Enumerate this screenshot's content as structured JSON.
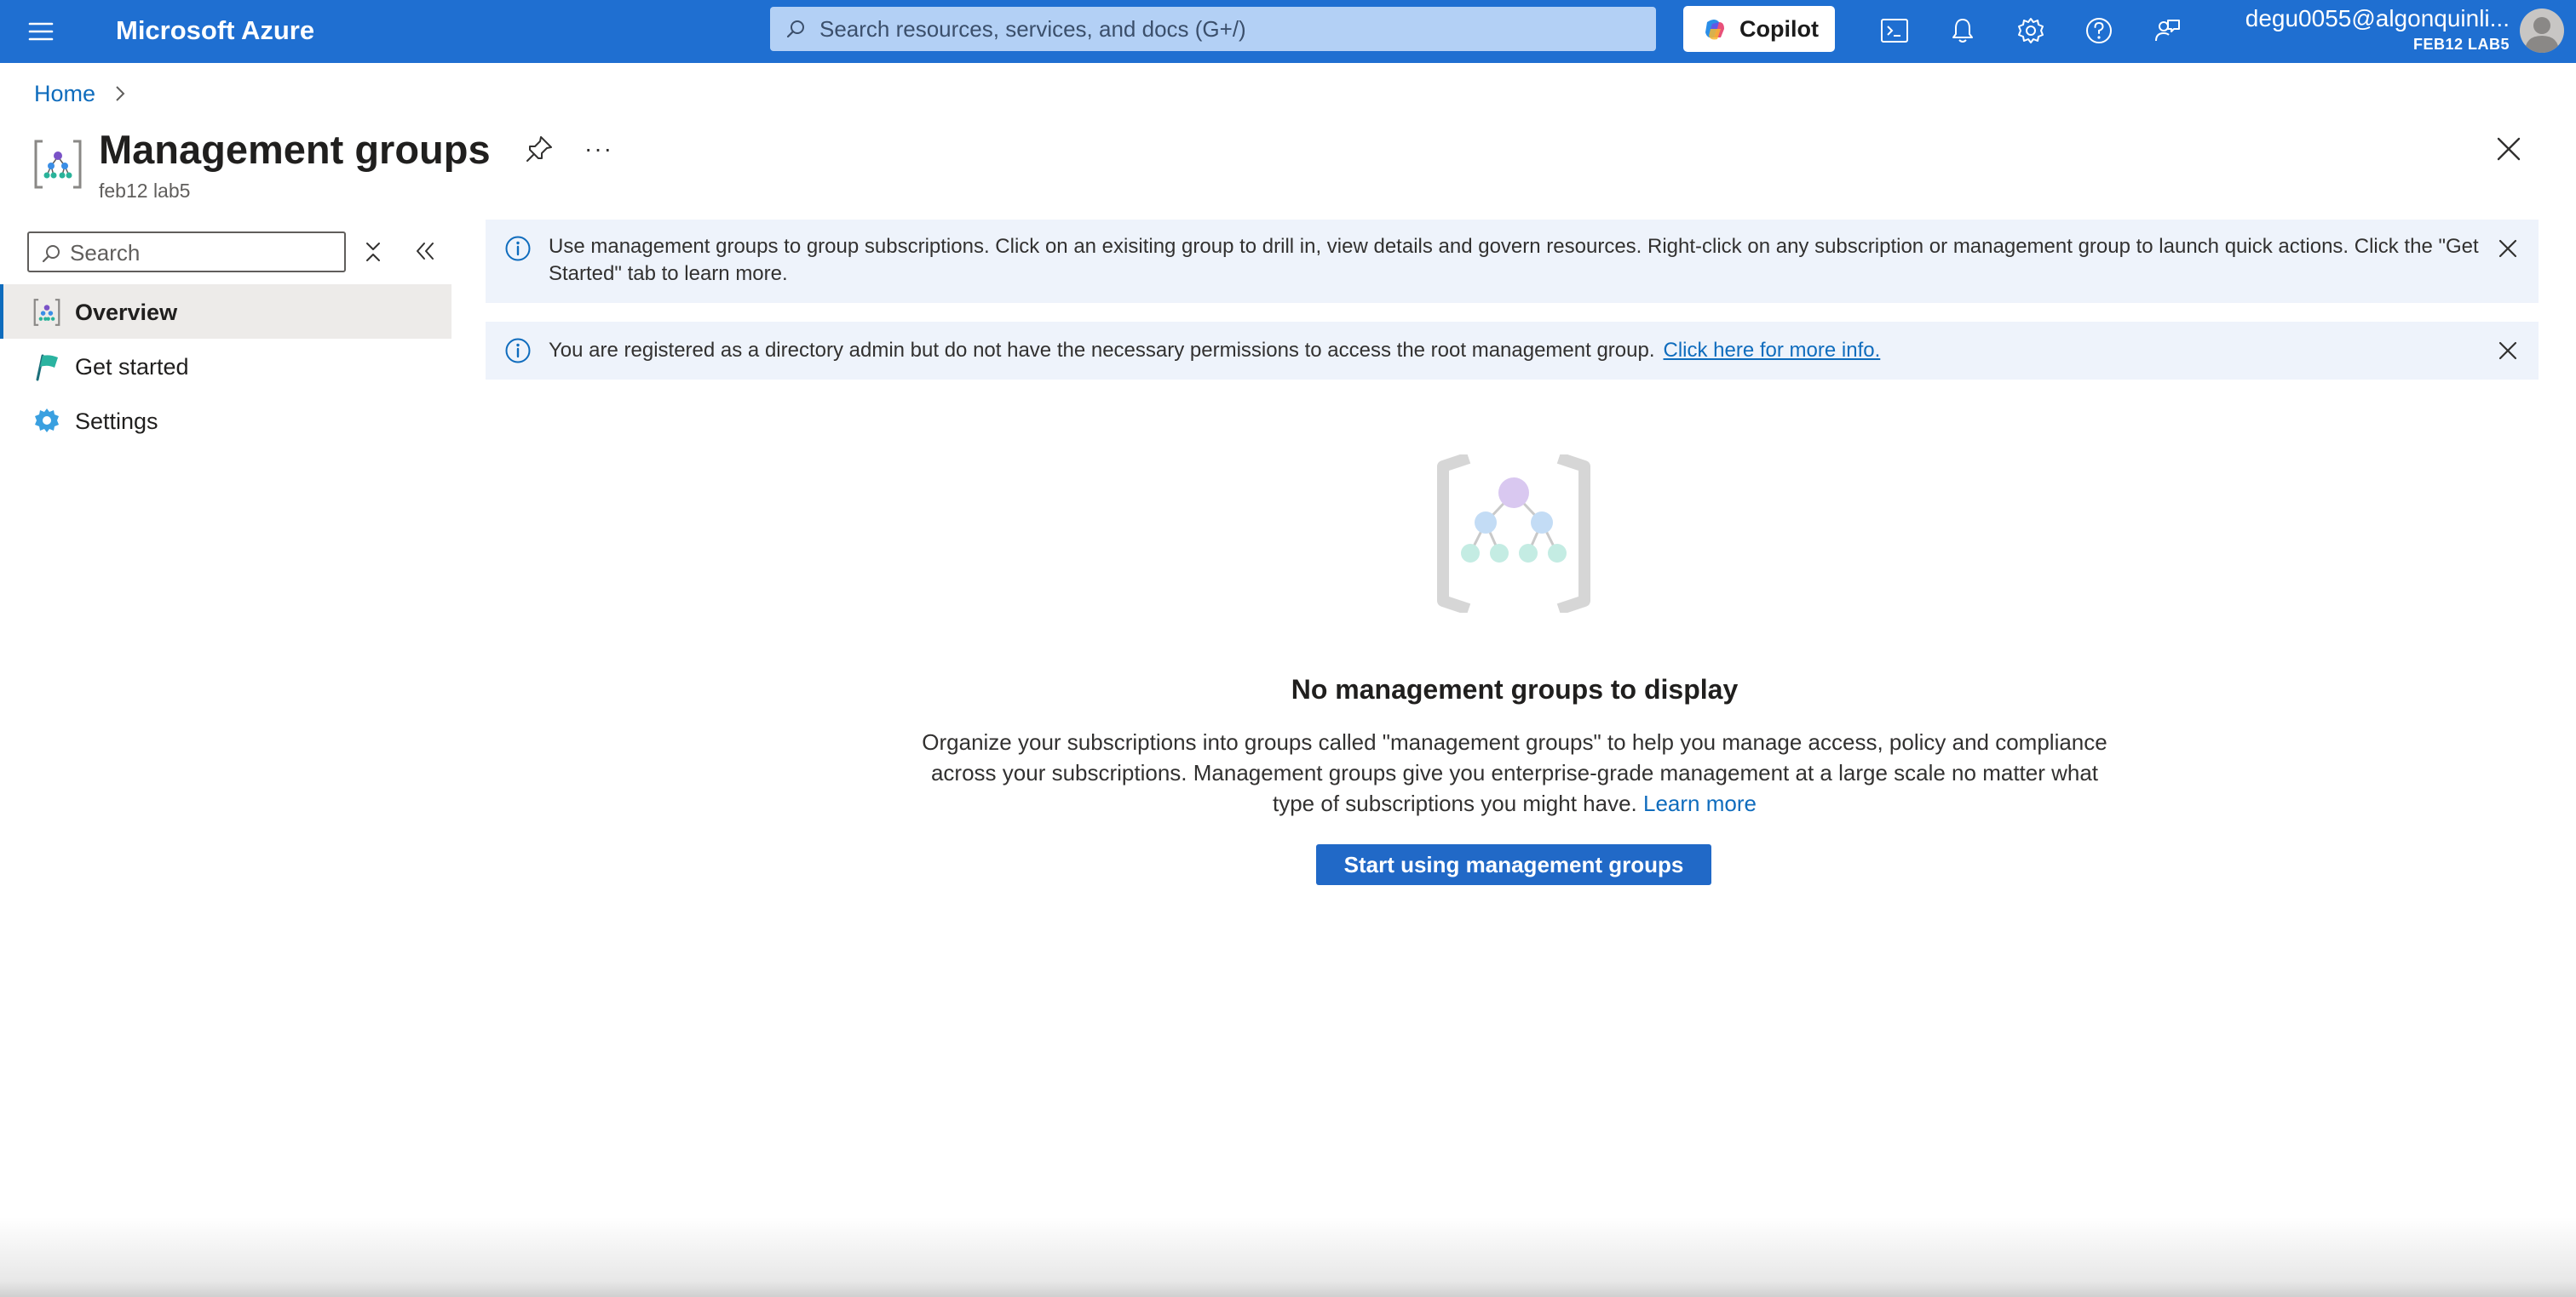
{
  "topbar": {
    "brand": "Microsoft Azure",
    "search_placeholder": "Search resources, services, and docs (G+/)",
    "copilot_label": "Copilot",
    "account_name": "degu0055@algonquinli...",
    "account_tenant": "FEB12 LAB5",
    "icons": [
      "menu-icon",
      "cloud-shell-icon",
      "bell-icon",
      "gear-icon",
      "help-icon",
      "feedback-icon"
    ]
  },
  "breadcrumb": {
    "home": "Home"
  },
  "header": {
    "title": "Management groups",
    "subtitle": "feb12 lab5",
    "more": "···"
  },
  "nav": {
    "search_placeholder": "Search",
    "items": [
      {
        "label": "Overview",
        "active": true
      },
      {
        "label": "Get started",
        "active": false
      },
      {
        "label": "Settings",
        "active": false
      }
    ]
  },
  "banners": {
    "info1": "Use management groups to group subscriptions. Click on an exisiting group to drill in, view details and govern resources. Right-click on any subscription or management group to launch quick actions. Click the \"Get Started\" tab to learn more.",
    "info2": "You are registered as a directory admin but do not have the necessary permissions to access the root management group.",
    "info2_link": "Click here for more info."
  },
  "empty_state": {
    "title": "No management groups to display",
    "description": "Organize your subscriptions into groups called \"management groups\" to help you manage access, policy and compliance across your subscriptions. Management groups give you enterprise-grade management at a large scale no matter what type of subscriptions you might have.",
    "learn_more": "Learn more",
    "button": "Start using management groups"
  },
  "colors": {
    "topbar": "#1f6fd1",
    "accent": "#0f6cbd",
    "banner_bg": "#eef3fb",
    "primary_button": "#2169c7"
  }
}
